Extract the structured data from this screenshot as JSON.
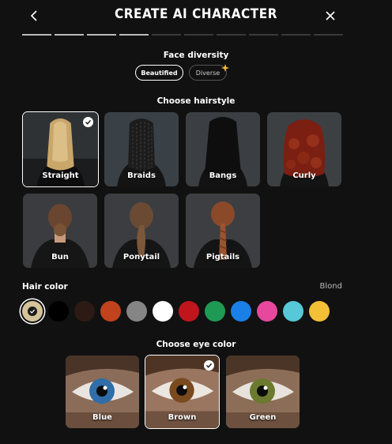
{
  "header": {
    "title": "CREATE AI CHARACTER",
    "back_icon": "chevron-left-icon",
    "close_icon": "close-icon"
  },
  "progress": {
    "total_steps": 10,
    "completed_steps": 4
  },
  "face_diversity": {
    "title": "Face diversity",
    "options": [
      {
        "label": "Beautified",
        "selected": true
      },
      {
        "label": "Diverse",
        "selected": false,
        "badge": "sparkle-icon"
      }
    ]
  },
  "hairstyle": {
    "title": "Choose hairstyle",
    "options": [
      {
        "label": "Straight",
        "selected": true
      },
      {
        "label": "Braids",
        "selected": false
      },
      {
        "label": "Bangs",
        "selected": false
      },
      {
        "label": "Curly",
        "selected": false
      },
      {
        "label": "Bun",
        "selected": false
      },
      {
        "label": "Ponytail",
        "selected": false
      },
      {
        "label": "Pigtails",
        "selected": false
      }
    ]
  },
  "hair_color": {
    "title": "Hair color",
    "selected_value": "Blond",
    "swatches": [
      {
        "name": "blond",
        "color": "#d4c39a",
        "selected": true
      },
      {
        "name": "black",
        "color": "#000000",
        "selected": false
      },
      {
        "name": "dark-brown",
        "color": "#2e1a14",
        "selected": false
      },
      {
        "name": "auburn",
        "color": "#c0431d",
        "selected": false
      },
      {
        "name": "gray",
        "color": "#858585",
        "selected": false
      },
      {
        "name": "white",
        "color": "#ffffff",
        "selected": false
      },
      {
        "name": "red",
        "color": "#c0151d",
        "selected": false
      },
      {
        "name": "green",
        "color": "#1f9a55",
        "selected": false
      },
      {
        "name": "blue",
        "color": "#1a7fe6",
        "selected": false
      },
      {
        "name": "pink",
        "color": "#e6489e",
        "selected": false
      },
      {
        "name": "cyan",
        "color": "#56c8d8",
        "selected": false
      },
      {
        "name": "yellow",
        "color": "#f2bf36",
        "selected": false
      }
    ]
  },
  "eye_color": {
    "title": "Choose eye color",
    "options": [
      {
        "label": "Blue",
        "selected": false
      },
      {
        "label": "Brown",
        "selected": true
      },
      {
        "label": "Green",
        "selected": false
      }
    ]
  }
}
